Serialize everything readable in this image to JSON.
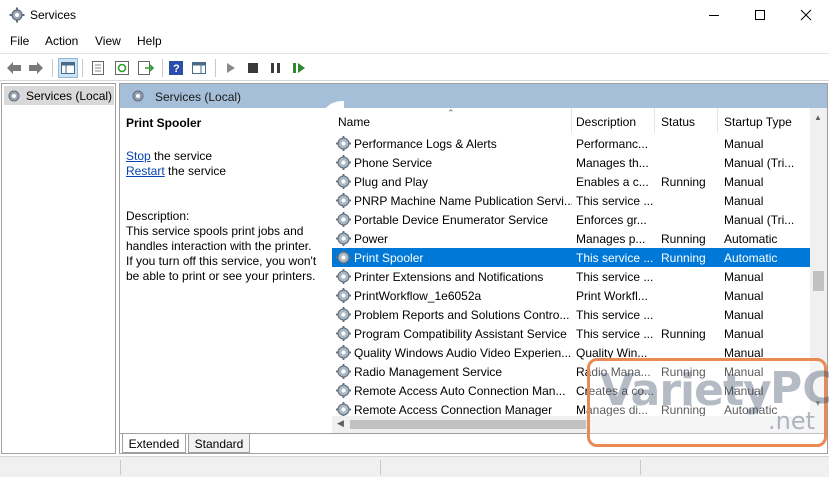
{
  "window": {
    "title": "Services",
    "icon": "gear-icon",
    "minimize_icon": "minimize-icon",
    "maximize_icon": "maximize-icon",
    "close_icon": "close-icon"
  },
  "menu": [
    "File",
    "Action",
    "View",
    "Help"
  ],
  "toolbar": {
    "icons": [
      "back-arrow-icon",
      "forward-arrow-icon",
      "show-hide-console-tree-icon",
      "properties-icon",
      "refresh-icon",
      "export-list-icon",
      "help-icon",
      "show-action-pane-icon",
      "start-service-icon",
      "stop-service-icon",
      "pause-service-icon",
      "restart-service-icon"
    ]
  },
  "tree": {
    "label": "Services (Local)"
  },
  "pane": {
    "title": "Services (Local)"
  },
  "detail": {
    "service_name": "Print Spooler",
    "stop_link": "Stop",
    "stop_rest": " the service",
    "restart_link": "Restart",
    "restart_rest": " the service",
    "desc_label": "Description:",
    "desc_lines": [
      "This service spools print jobs and",
      "handles interaction with the printer.",
      "If you turn off this service, you won't",
      "be able to print or see your printers."
    ]
  },
  "columns": [
    "Name",
    "Description",
    "Status",
    "Startup Type"
  ],
  "rows": [
    {
      "name": "Performance Logs & Alerts",
      "desc": "Performanc...",
      "status": "",
      "startup": "Manual"
    },
    {
      "name": "Phone Service",
      "desc": "Manages th...",
      "status": "",
      "startup": "Manual (Tri..."
    },
    {
      "name": "Plug and Play",
      "desc": "Enables a c...",
      "status": "Running",
      "startup": "Manual"
    },
    {
      "name": "PNRP Machine Name Publication Servi...",
      "desc": "This service ...",
      "status": "",
      "startup": "Manual"
    },
    {
      "name": "Portable Device Enumerator Service",
      "desc": "Enforces gr...",
      "status": "",
      "startup": "Manual (Tri..."
    },
    {
      "name": "Power",
      "desc": "Manages p...",
      "status": "Running",
      "startup": "Automatic"
    },
    {
      "name": "Print Spooler",
      "desc": "This service ...",
      "status": "Running",
      "startup": "Automatic",
      "selected": true
    },
    {
      "name": "Printer Extensions and Notifications",
      "desc": "This service ...",
      "status": "",
      "startup": "Manual"
    },
    {
      "name": "PrintWorkflow_1e6052a",
      "desc": "Print Workfl...",
      "status": "",
      "startup": "Manual"
    },
    {
      "name": "Problem Reports and Solutions Contro...",
      "desc": "This service ...",
      "status": "",
      "startup": "Manual"
    },
    {
      "name": "Program Compatibility Assistant Service",
      "desc": "This service ...",
      "status": "Running",
      "startup": "Manual"
    },
    {
      "name": "Quality Windows Audio Video Experien...",
      "desc": "Quality Win...",
      "status": "",
      "startup": "Manual"
    },
    {
      "name": "Radio Management Service",
      "desc": "Radio Mana...",
      "status": "Running",
      "startup": "Manual"
    },
    {
      "name": "Remote Access Auto Connection Man...",
      "desc": "Creates a co...",
      "status": "",
      "startup": "Manual"
    },
    {
      "name": "Remote Access Connection Manager",
      "desc": "Manages di...",
      "status": "Running",
      "startup": "Automatic"
    }
  ],
  "tabs": [
    "Extended",
    "Standard"
  ],
  "watermark": {
    "part1": "Variety",
    "part2": "PC",
    "part3": ".net"
  },
  "colors": {
    "selection": "#0078d7",
    "header_band": "#a6bfd9",
    "link": "#0645ad",
    "watermark_border": "#e88a52"
  }
}
